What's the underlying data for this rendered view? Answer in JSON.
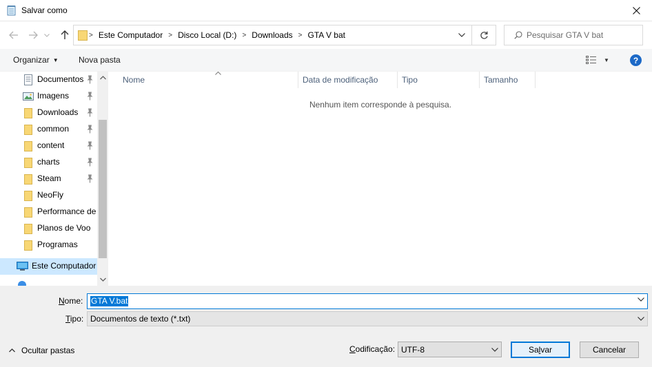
{
  "window": {
    "title": "Salvar como",
    "app_icon": "notepad-icon",
    "close_icon": "close-icon"
  },
  "address": {
    "back_icon": "back-arrow-icon",
    "forward_icon": "forward-arrow-icon",
    "recent_icon": "chevron-down-icon",
    "up_icon": "up-arrow-icon",
    "breadcrumbs": [
      "Este Computador",
      "Disco Local (D:)",
      "Downloads",
      "GTA V bat"
    ],
    "refresh_icon": "refresh-icon",
    "search_placeholder": "Pesquisar GTA V bat",
    "search_icon": "search-icon"
  },
  "toolbar": {
    "organize_label": "Organizar",
    "new_folder_label": "Nova pasta",
    "view_icon": "view-options-icon",
    "help_label": "?"
  },
  "nav": {
    "items": [
      {
        "label": "Documentos",
        "icon": "documents-icon",
        "pinned": true
      },
      {
        "label": "Imagens",
        "icon": "pictures-icon",
        "pinned": true
      },
      {
        "label": "Downloads",
        "icon": "folder-icon",
        "pinned": true
      },
      {
        "label": "common",
        "icon": "folder-icon",
        "pinned": true
      },
      {
        "label": "content",
        "icon": "folder-icon",
        "pinned": true
      },
      {
        "label": "charts",
        "icon": "folder-icon",
        "pinned": true
      },
      {
        "label": "Steam",
        "icon": "folder-icon",
        "pinned": true
      },
      {
        "label": "NeoFly",
        "icon": "folder-icon",
        "pinned": false
      },
      {
        "label": "Performance de",
        "icon": "folder-icon",
        "pinned": false
      },
      {
        "label": "Planos de Voo",
        "icon": "folder-icon",
        "pinned": false
      },
      {
        "label": "Programas",
        "icon": "folder-icon",
        "pinned": false
      }
    ],
    "this_pc_label": "Este Computador"
  },
  "filelist": {
    "columns": [
      "Nome",
      "Data de modificação",
      "Tipo",
      "Tamanho"
    ],
    "empty_message": "Nenhum item corresponde à pesquisa."
  },
  "form": {
    "name_label_accel": "N",
    "name_label_rest": "ome:",
    "name_value": "GTA V.bat",
    "type_label_accel": "T",
    "type_label_rest": "ipo:",
    "type_value": "Documentos de texto (*.txt)",
    "encoding_label_accel": "C",
    "encoding_label_rest": "odificação:",
    "encoding_value": "UTF-8",
    "hide_folders_label": "Ocultar pastas",
    "save_pre": "Sa",
    "save_accel": "l",
    "save_post": "var",
    "cancel_label": "Cancelar"
  },
  "colors": {
    "accent": "#0078d7",
    "folder": "#f8d775",
    "help_bg": "#1c69c7",
    "selected_nav": "#cce8ff"
  }
}
